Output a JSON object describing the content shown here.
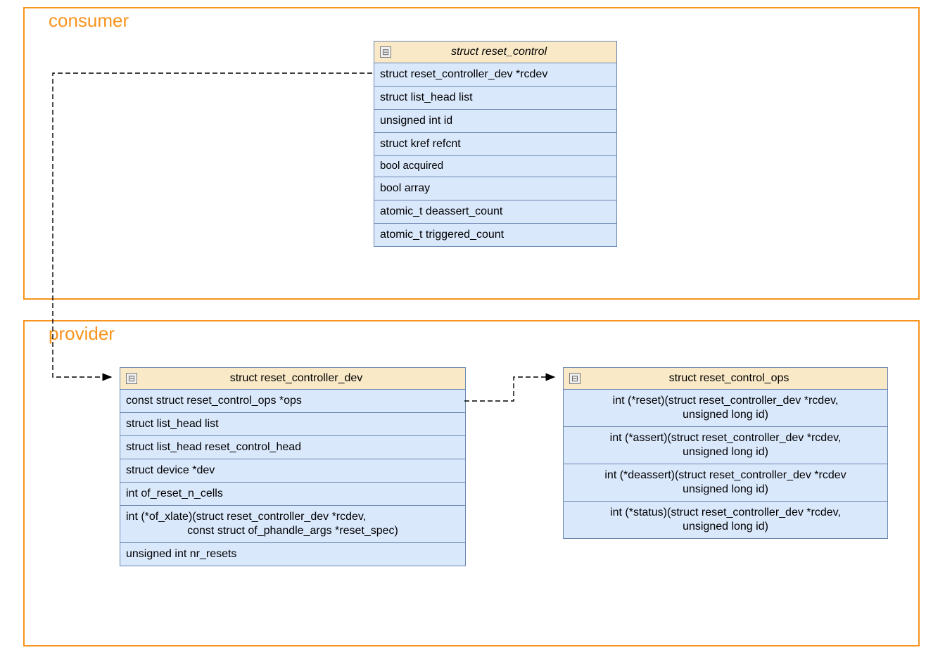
{
  "groups": {
    "consumer": "consumer",
    "provider": "provider"
  },
  "reset_control": {
    "title": "struct reset_control",
    "rows": [
      "struct reset_controller_dev *rcdev",
      "struct list_head list",
      "unsigned int id",
      "struct kref refcnt",
      "bool acquired",
      "bool array",
      "atomic_t deassert_count",
      "atomic_t triggered_count"
    ]
  },
  "reset_controller_dev": {
    "title": "struct reset_controller_dev",
    "rows": [
      "const struct reset_control_ops *ops",
      "struct list_head list",
      "struct list_head reset_control_head",
      "struct device *dev",
      "int of_reset_n_cells"
    ],
    "of_xlate_l1": "int (*of_xlate)(struct reset_controller_dev *rcdev,",
    "of_xlate_l2": "const struct of_phandle_args *reset_spec)",
    "last": "unsigned int nr_resets"
  },
  "reset_control_ops": {
    "title": "struct reset_control_ops",
    "reset_l1": "int (*reset)(struct reset_controller_dev *rcdev,",
    "reset_l2": "unsigned long id)",
    "assert_l1": "int (*assert)(struct reset_controller_dev *rcdev,",
    "assert_l2": "unsigned long id)",
    "deassert_l1": "int (*deassert)(struct reset_controller_dev *rcdev",
    "deassert_l2": "unsigned long id)",
    "status_l1": "int (*status)(struct reset_controller_dev *rcdev,",
    "status_l2": "unsigned long id)"
  },
  "toggle_glyph": "⊟"
}
